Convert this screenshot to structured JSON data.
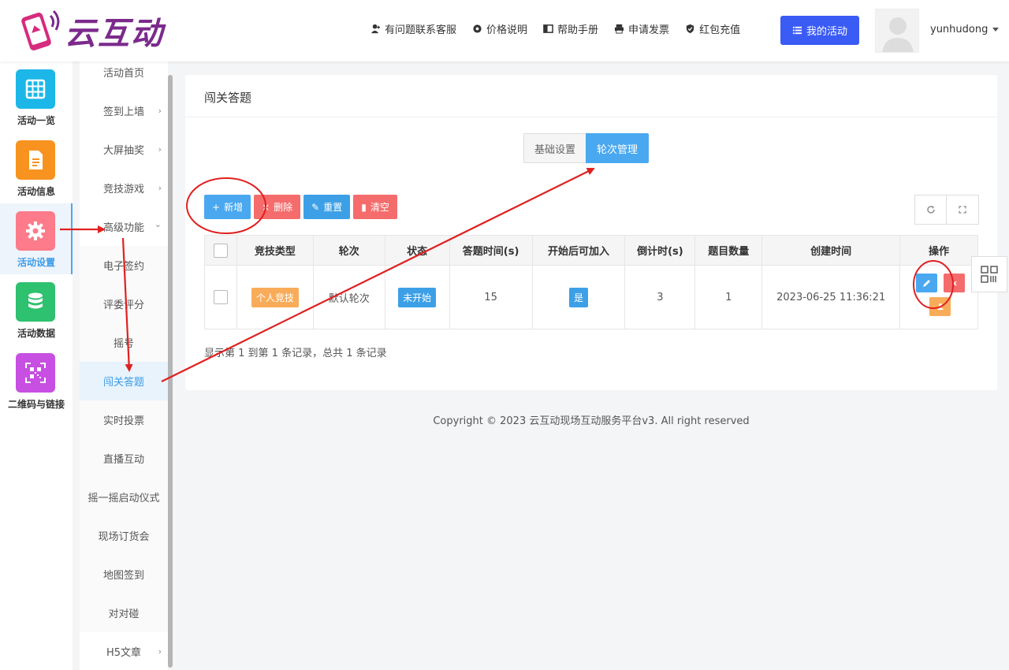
{
  "header": {
    "logo_text": "云互动",
    "links": [
      {
        "label": "有问题联系客服",
        "icon": "add-user-icon"
      },
      {
        "label": "价格说明",
        "icon": "gear-icon"
      },
      {
        "label": "帮助手册",
        "icon": "book-icon"
      },
      {
        "label": "申请发票",
        "icon": "printer-icon"
      },
      {
        "label": "红包充值",
        "icon": "shield-check-icon"
      }
    ],
    "my_activity": "我的活动",
    "username": "yunhudong"
  },
  "rail": [
    {
      "label": "活动一览",
      "icon": "grid-icon",
      "color": "#1cb7e8"
    },
    {
      "label": "活动信息",
      "icon": "document-icon",
      "color": "#f7931e"
    },
    {
      "label": "活动设置",
      "icon": "gear-icon",
      "color": "#fd7b8a",
      "active": true
    },
    {
      "label": "活动数据",
      "icon": "database-icon",
      "color": "#2ec16f"
    },
    {
      "label": "二维码与链接",
      "icon": "qrcode-icon",
      "color": "#c74fe2"
    }
  ],
  "submenu": [
    {
      "label": "活动首页"
    },
    {
      "label": "签到上墙",
      "arrow": "›"
    },
    {
      "label": "大屏抽奖",
      "arrow": "›"
    },
    {
      "label": "竞技游戏",
      "arrow": "›"
    },
    {
      "label": "高级功能",
      "arrow": "⌄"
    },
    {
      "label": "电子签约"
    },
    {
      "label": "评委评分"
    },
    {
      "label": "摇号"
    },
    {
      "label": "闯关答题",
      "active": true
    },
    {
      "label": "实时投票"
    },
    {
      "label": "直播互动"
    },
    {
      "label": "摇一摇启动仪式"
    },
    {
      "label": "现场订货会"
    },
    {
      "label": "地图签到"
    },
    {
      "label": "对对碰"
    },
    {
      "label": "H5文章",
      "arrow": "›"
    }
  ],
  "card": {
    "title": "闯关答题",
    "tabs": [
      "基础设置",
      "轮次管理"
    ],
    "toolbar": [
      {
        "label": "新增",
        "icon": "+",
        "color": "blue"
      },
      {
        "label": "删除",
        "icon": "×",
        "color": "red"
      },
      {
        "label": "重置",
        "icon": "✎",
        "color": "sky"
      },
      {
        "label": "清空",
        "icon": "▮",
        "color": "red"
      }
    ],
    "columns": [
      "竞技类型",
      "轮次",
      "状态",
      "答题时间(s)",
      "开始后可加入",
      "倒计时(s)",
      "题目数量",
      "创建时间",
      "操作"
    ],
    "rows": [
      {
        "type": "个人竞技",
        "round": "默认轮次",
        "status": "未开始",
        "time": "15",
        "joinable": "是",
        "countdown": "3",
        "questions": "1",
        "created": "2023-06-25 11:36:21"
      }
    ],
    "summary": "显示第 1 到第 1 条记录，总共 1 条记录"
  },
  "footer": "Copyright © 2023 云互动现场互动服务平台v3. All right reserved"
}
